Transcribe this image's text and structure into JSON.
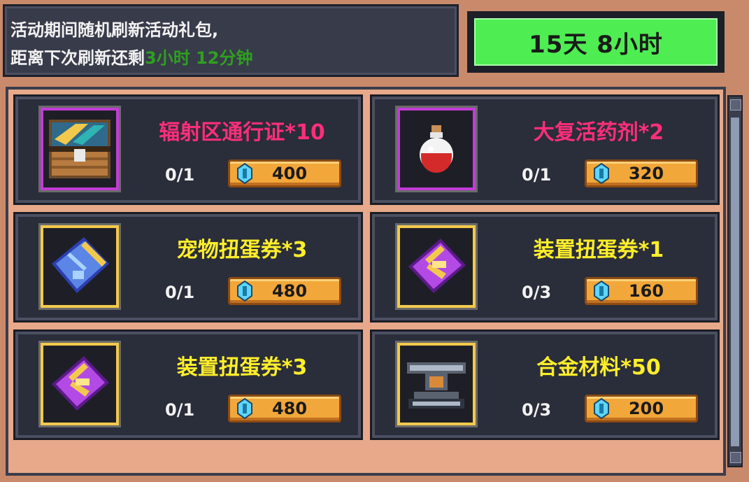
{
  "info": {
    "line1": "活动期间随机刷新活动礼包,",
    "line2_prefix": "距离下次刷新还剩",
    "line2_time": "3小时 12分钟"
  },
  "timer": {
    "label": "15天  8小时"
  },
  "items": [
    {
      "name": "辐射区通行证*10",
      "progress": "0/1",
      "price": "400",
      "name_color": "#ff2e7a",
      "frame": "purple",
      "icon": "chest-icon"
    },
    {
      "name": "大复活药剂*2",
      "progress": "0/1",
      "price": "320",
      "name_color": "#ff2e7a",
      "frame": "purple",
      "icon": "potion-icon"
    },
    {
      "name": "宠物扭蛋券*3",
      "progress": "0/1",
      "price": "480",
      "name_color": "#ffee2a",
      "frame": "gold",
      "icon": "blue-ticket-icon"
    },
    {
      "name": "装置扭蛋券*1",
      "progress": "0/3",
      "price": "160",
      "name_color": "#ffee2a",
      "frame": "gold",
      "icon": "purple-ticket-icon"
    },
    {
      "name": "装置扭蛋券*3",
      "progress": "0/1",
      "price": "480",
      "name_color": "#ffee2a",
      "frame": "gold",
      "icon": "purple-ticket-icon"
    },
    {
      "name": "合金材料*50",
      "progress": "0/3",
      "price": "200",
      "name_color": "#ffee2a",
      "frame": "gold",
      "icon": "alloy-icon"
    }
  ]
}
